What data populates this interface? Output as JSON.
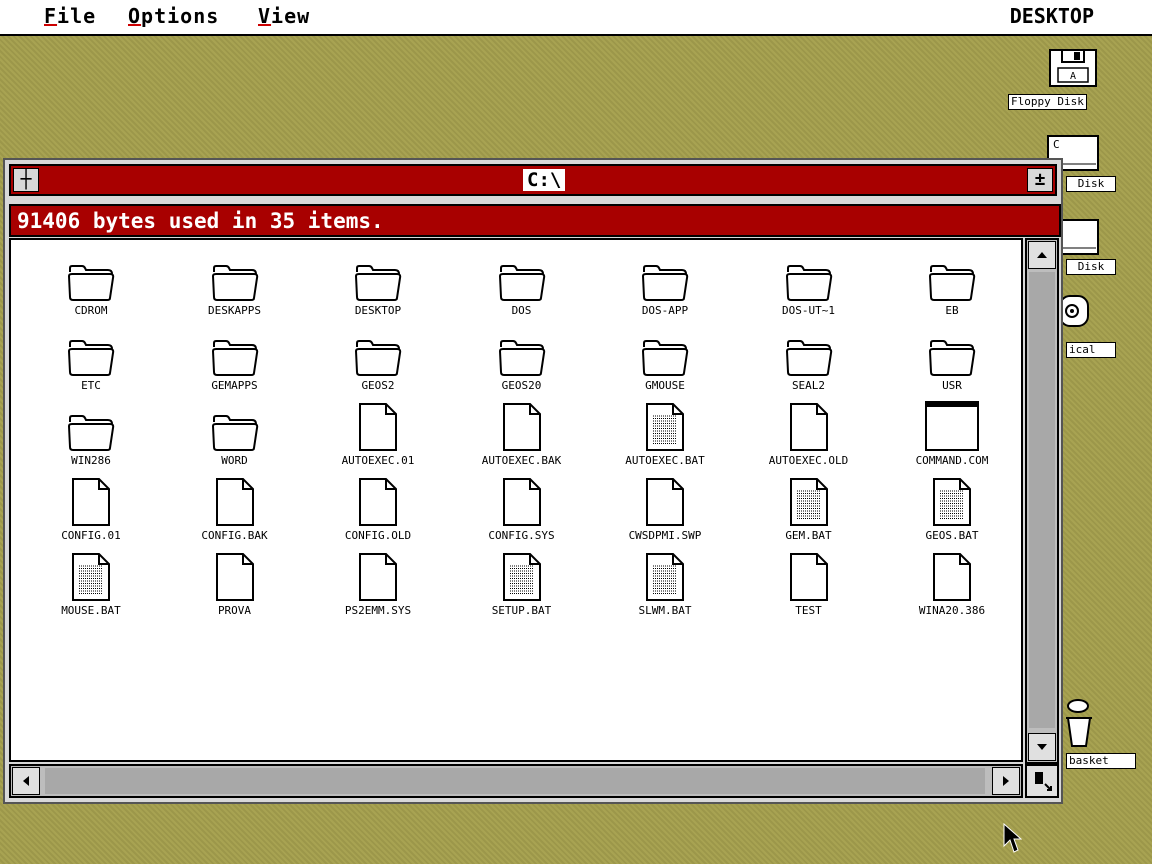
{
  "menubar": {
    "items": [
      {
        "accel": "F",
        "rest": "ile"
      },
      {
        "accel": "O",
        "rest": "ptions"
      },
      {
        "accel": "V",
        "rest": "iew"
      }
    ],
    "title": "DESKTOP"
  },
  "desktop_icons": [
    {
      "label": "Floppy Disk",
      "icon": "floppy-disk-icon",
      "drive": "A"
    },
    {
      "label": "Disk",
      "icon": "hard-disk-icon",
      "drive": "C"
    },
    {
      "label": "Disk",
      "icon": "hard-disk-icon",
      "drive": ""
    },
    {
      "label": "ical",
      "icon": "cd-drive-icon"
    },
    {
      "label": "basket",
      "icon": "trash-icon"
    }
  ],
  "window": {
    "close_glyph": "┼",
    "title": "C:\\",
    "full_glyph": "±",
    "info": "91406 bytes used in 35 items.",
    "items": [
      {
        "name": "CDROM",
        "type": "folder"
      },
      {
        "name": "DESKAPPS",
        "type": "folder"
      },
      {
        "name": "DESKTOP",
        "type": "folder"
      },
      {
        "name": "DOS",
        "type": "folder"
      },
      {
        "name": "DOS-APP",
        "type": "folder"
      },
      {
        "name": "DOS-UT~1",
        "type": "folder"
      },
      {
        "name": "EB",
        "type": "folder"
      },
      {
        "name": "ETC",
        "type": "folder"
      },
      {
        "name": "GEMAPPS",
        "type": "folder"
      },
      {
        "name": "GEOS2",
        "type": "folder"
      },
      {
        "name": "GEOS20",
        "type": "folder"
      },
      {
        "name": "GMOUSE",
        "type": "folder"
      },
      {
        "name": "SEAL2",
        "type": "folder"
      },
      {
        "name": "USR",
        "type": "folder"
      },
      {
        "name": "WIN286",
        "type": "folder"
      },
      {
        "name": "WORD",
        "type": "folder"
      },
      {
        "name": "AUTOEXEC.01",
        "type": "file"
      },
      {
        "name": "AUTOEXEC.BAK",
        "type": "file"
      },
      {
        "name": "AUTOEXEC.BAT",
        "type": "batch"
      },
      {
        "name": "AUTOEXEC.OLD",
        "type": "file"
      },
      {
        "name": "COMMAND.COM",
        "type": "program"
      },
      {
        "name": "CONFIG.01",
        "type": "file"
      },
      {
        "name": "CONFIG.BAK",
        "type": "file"
      },
      {
        "name": "CONFIG.OLD",
        "type": "file"
      },
      {
        "name": "CONFIG.SYS",
        "type": "file"
      },
      {
        "name": "CWSDPMI.SWP",
        "type": "file"
      },
      {
        "name": "GEM.BAT",
        "type": "batch"
      },
      {
        "name": "GEOS.BAT",
        "type": "batch"
      },
      {
        "name": "MOUSE.BAT",
        "type": "batch"
      },
      {
        "name": "PROVA",
        "type": "file"
      },
      {
        "name": "PS2EMM.SYS",
        "type": "file"
      },
      {
        "name": "SETUP.BAT",
        "type": "batch"
      },
      {
        "name": "SLWM.BAT",
        "type": "batch"
      },
      {
        "name": "TEST",
        "type": "file"
      },
      {
        "name": "WINA20.386",
        "type": "file"
      }
    ]
  },
  "colors": {
    "desktop": "#a8a352",
    "titlebar": "#a80000",
    "window_bg": "#ffffff"
  }
}
